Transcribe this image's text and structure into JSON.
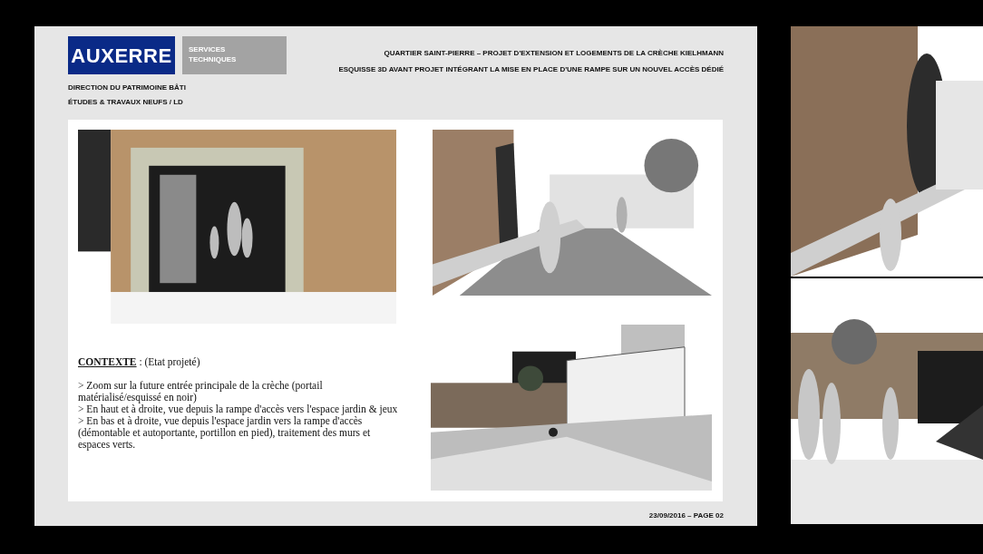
{
  "slide": {
    "logo": "AUXERRE",
    "service": [
      "SERVICES",
      "TECHNIQUES"
    ],
    "department": [
      "DIRECTION DU PATRIMOINE BÂTI",
      "ÉTUDES & TRAVAUX NEUFS / LD"
    ],
    "title": [
      "QUARTIER SAINT-PIERRE – PROJET D'EXTENSION ET LOGEMENTS DE LA CRÈCHE KIELHMANN",
      "ESQUISSE 3D AVANT PROJET INTÉGRANT LA MISE EN PLACE D'UNE RAMPE SUR UN NOUVEL ACCÈS DÉDIÉ"
    ],
    "context": {
      "heading": "**CONTEXTE** : (Etat projeté)",
      "lines": [
        "> Zoom sur la future entrée principale de la crèche (portail matérialisé/esquissé en noir)",
        "> En haut et à droite, vue depuis la rampe d'accès vers l'espace jardin & jeux",
        "> En bas et à droite, vue depuis l'espace jardin vers la rampe d'accès (démontable et autoportante, portillon en pied), traitement des murs et espaces verts."
      ]
    },
    "footer": "23/09/2016 – PAGE 02"
  }
}
